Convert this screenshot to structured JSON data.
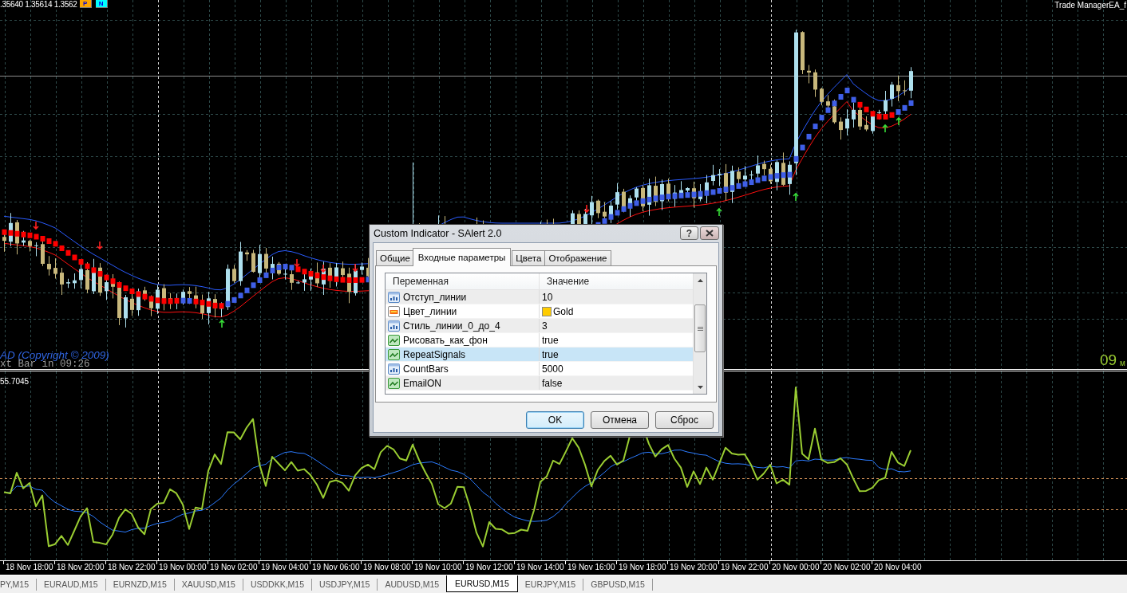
{
  "chart": {
    "quote": ".35640 1.35614 1.3562",
    "buttons": [
      {
        "label": "P",
        "color": "#ffa500"
      },
      {
        "label": "N",
        "color": "#00ffff"
      }
    ],
    "expert": "Trade ManagerEA_f",
    "copyright": "AD (Copyright © 2009)",
    "next_bar": "xt Bar in 09:26",
    "timer": "09",
    "timer_unit": "м"
  },
  "indicator": {
    "value": "55.7045"
  },
  "dialog": {
    "title": "Custom Indicator - SAlert 2.0",
    "help_button": "?",
    "tabs": [
      {
        "label": "Общие",
        "selected": false
      },
      {
        "label": "Входные параметры",
        "selected": true
      },
      {
        "label": "Цвета",
        "selected": false
      },
      {
        "label": "Отображение",
        "selected": false
      }
    ],
    "columns": [
      "Переменная",
      "Значение"
    ],
    "params": [
      {
        "kind": "int",
        "name": "Отступ_линии",
        "value": "10",
        "selected": false
      },
      {
        "kind": "color",
        "name": "Цвет_линии",
        "value": "Gold",
        "color": "#ffcc00",
        "selected": false
      },
      {
        "kind": "int",
        "name": "Стиль_линии_0_до_4",
        "value": "3",
        "selected": false
      },
      {
        "kind": "bool",
        "name": "Рисовать_как_фон",
        "value": "true",
        "selected": false
      },
      {
        "kind": "bool",
        "name": "RepeatSignals",
        "value": "true",
        "selected": true
      },
      {
        "kind": "int",
        "name": "CountBars",
        "value": "5000",
        "selected": false
      },
      {
        "kind": "bool",
        "name": "EmailON",
        "value": "false",
        "selected": false
      }
    ],
    "buttons": [
      {
        "label": "OK",
        "default": true
      },
      {
        "label": "Отмена",
        "default": false
      },
      {
        "label": "Сброс",
        "default": false
      }
    ]
  },
  "time_axis": [
    "18 Nov 18:00",
    "18 Nov 20:00",
    "18 Nov 22:00",
    "19 Nov 00:00",
    "19 Nov 02:00",
    "19 Nov 04:00",
    "19 Nov 06:00",
    "19 Nov 08:00",
    "19 Nov 10:00",
    "19 Nov 12:00",
    "19 Nov 14:00",
    "19 Nov 16:00",
    "19 Nov 18:00",
    "19 Nov 20:00",
    "19 Nov 22:00",
    "20 Nov 00:00",
    "20 Nov 02:00",
    "20 Nov 04:00"
  ],
  "symbol_tabs": [
    {
      "label": "PY,M15",
      "selected": false
    },
    {
      "label": "EURAUD,M15",
      "selected": false
    },
    {
      "label": "EURNZD,M15",
      "selected": false
    },
    {
      "label": "XAUUSD,M15",
      "selected": false
    },
    {
      "label": "USDDKK,M15",
      "selected": false
    },
    {
      "label": "USDJPY,M15",
      "selected": false
    },
    {
      "label": "AUDUSD,M15",
      "selected": false
    },
    {
      "label": "EURUSD,M15",
      "selected": true
    },
    {
      "label": "EURJPY,M15",
      "selected": false
    },
    {
      "label": "GBPUSD,M15",
      "selected": false
    }
  ]
}
